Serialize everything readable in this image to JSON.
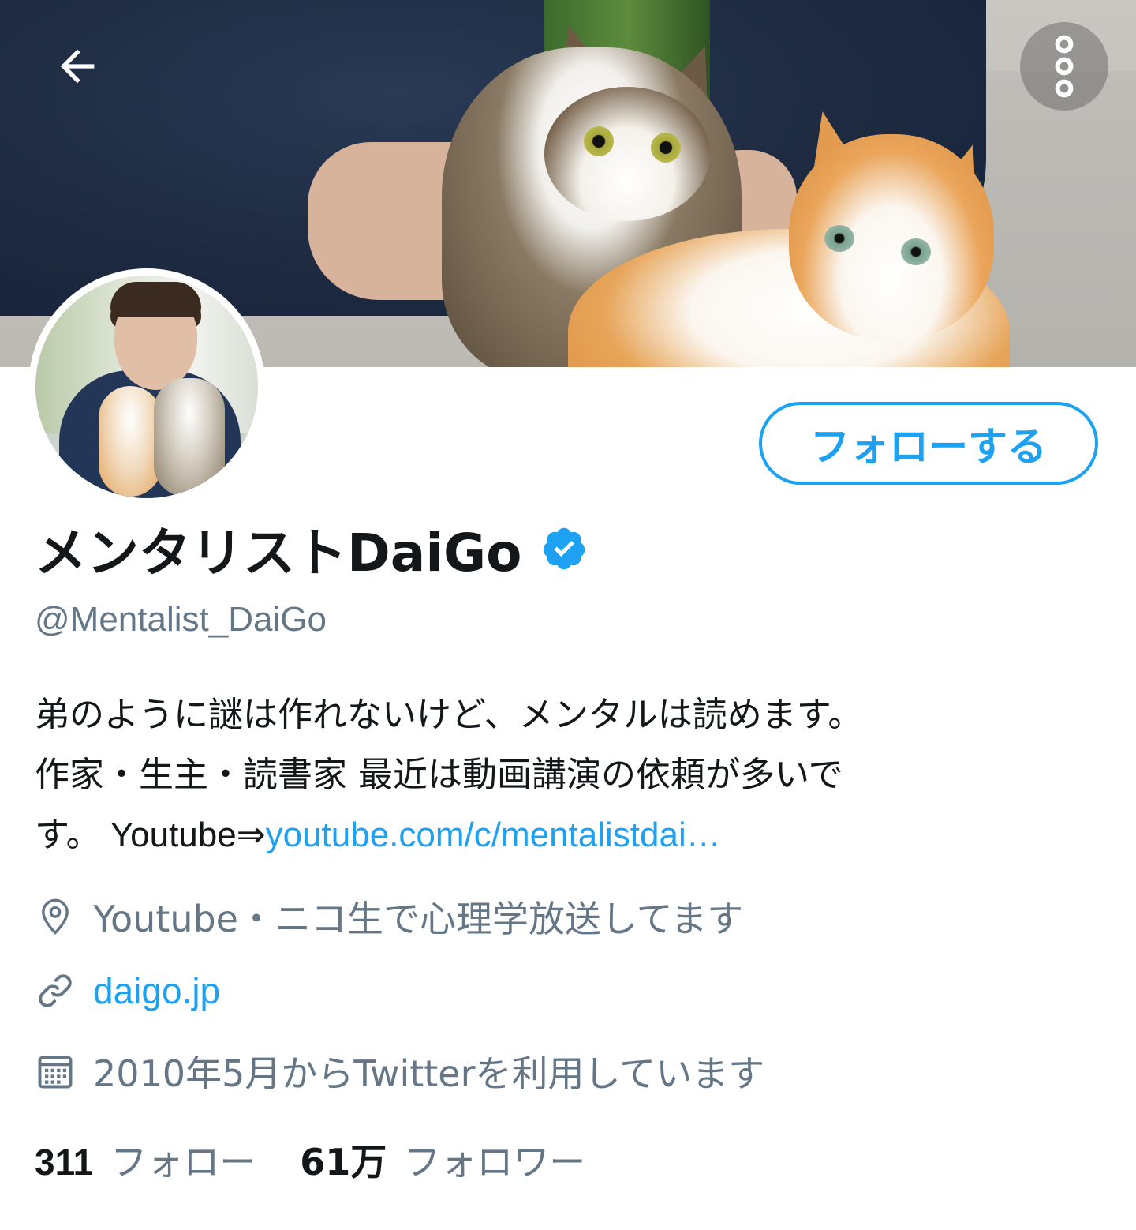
{
  "header": {
    "back_icon": "arrow-left-icon",
    "more_icon": "more-vertical-icon"
  },
  "profile": {
    "follow_button": "フォローする",
    "display_name": "メンタリストDaiGo",
    "verified_icon": "verified-badge-icon",
    "handle": "@Mentalist_DaiGo",
    "bio_line1": "弟のように謎は作れないけど、メンタルは読めます。",
    "bio_line2": "作家・生主・読書家 最近は動画講演の依頼が多いで",
    "bio_line3_prefix": "す。",
    "bio_line3_text": " Youtube⇒",
    "bio_link": "youtube.com/c/mentalistdai…",
    "location": "Youtube・ニコ生で心理学放送してます",
    "location_icon": "location-pin-icon",
    "website": "daigo.jp",
    "website_icon": "link-icon",
    "joined": "2010年5月からTwitterを利用しています",
    "joined_icon": "calendar-icon",
    "following_count": "311",
    "following_label": "フォロー",
    "followers_count": "61万",
    "followers_label": "フォロワー"
  },
  "colors": {
    "accent": "#1da1f2",
    "secondary_text": "#657786",
    "primary_text": "#14171a"
  }
}
